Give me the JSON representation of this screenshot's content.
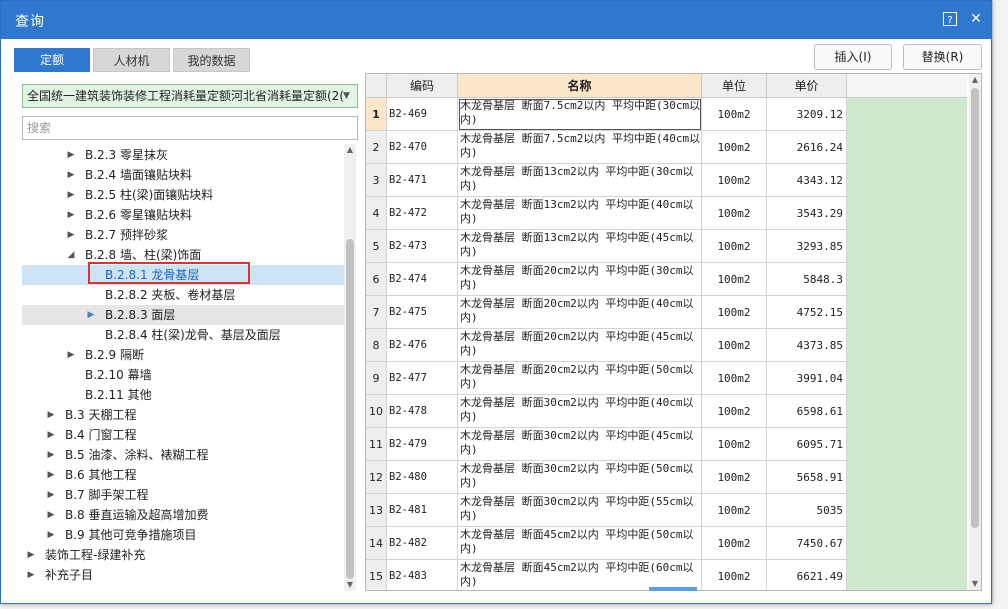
{
  "dialog": {
    "title": "查询",
    "help_icon": "?",
    "close_icon": "✕"
  },
  "tabs": [
    {
      "label": "定额",
      "active": true
    },
    {
      "label": "人材机",
      "active": false
    },
    {
      "label": "我的数据",
      "active": false
    }
  ],
  "actions": {
    "insert_label": "插入(I)",
    "replace_label": "替换(R)"
  },
  "library_select": {
    "value": "全国统一建筑装饰装修工程消耗量定额河北省消耗量定额(2("
  },
  "search": {
    "placeholder": "搜索"
  },
  "tree": {
    "items": [
      {
        "label": "B.2.3 零星抹灰",
        "expanded": false
      },
      {
        "label": "B.2.4 墙面镶贴块料",
        "expanded": false
      },
      {
        "label": "B.2.5 柱(梁)面镶贴块料",
        "expanded": false
      },
      {
        "label": "B.2.6 零星镶贴块料",
        "expanded": false
      },
      {
        "label": "B.2.7 预拌砂浆",
        "expanded": false
      },
      {
        "label": "B.2.8 墙、柱(梁)饰面",
        "expanded": true
      },
      {
        "label": "B.2.8.1 龙骨基层",
        "selected": true
      },
      {
        "label": "B.2.8.2 夹板、卷材基层"
      },
      {
        "label": "B.2.8.3 面层",
        "hover": true
      },
      {
        "label": "B.2.8.4 柱(梁)龙骨、基层及面层"
      },
      {
        "label": "B.2.9 隔断",
        "expanded": false
      },
      {
        "label": "B.2.10 幕墙"
      },
      {
        "label": "B.2.11 其他"
      },
      {
        "label": "B.3 天棚工程",
        "expanded": false
      },
      {
        "label": "B.4 门窗工程",
        "expanded": false
      },
      {
        "label": "B.5 油漆、涂料、裱糊工程",
        "expanded": false
      },
      {
        "label": "B.6 其他工程",
        "expanded": false
      },
      {
        "label": "B.7 脚手架工程",
        "expanded": false
      },
      {
        "label": "B.8 垂直运输及超高增加费",
        "expanded": false
      },
      {
        "label": "B.9 其他可竞争措施项目",
        "expanded": false
      },
      {
        "label": "装饰工程-绿建补充",
        "expanded": false
      },
      {
        "label": "补充子目",
        "expanded": false
      }
    ]
  },
  "grid": {
    "headers": {
      "rownum": "",
      "code": "编码",
      "name": "名称",
      "unit": "单位",
      "price": "单价"
    },
    "rows": [
      {
        "n": "1",
        "code": "B2-469",
        "name": "木龙骨基层 断面7.5cm2以内 平均中距(30cm以内)",
        "unit": "100m2",
        "price": "3209.12"
      },
      {
        "n": "2",
        "code": "B2-470",
        "name": "木龙骨基层 断面7.5cm2以内 平均中距(40cm以内)",
        "unit": "100m2",
        "price": "2616.24"
      },
      {
        "n": "3",
        "code": "B2-471",
        "name": "木龙骨基层 断面13cm2以内 平均中距(30cm以内)",
        "unit": "100m2",
        "price": "4343.12"
      },
      {
        "n": "4",
        "code": "B2-472",
        "name": "木龙骨基层 断面13cm2以内 平均中距(40cm以内)",
        "unit": "100m2",
        "price": "3543.29"
      },
      {
        "n": "5",
        "code": "B2-473",
        "name": "木龙骨基层 断面13cm2以内 平均中距(45cm以内)",
        "unit": "100m2",
        "price": "3293.85"
      },
      {
        "n": "6",
        "code": "B2-474",
        "name": "木龙骨基层 断面20cm2以内 平均中距(30cm以内)",
        "unit": "100m2",
        "price": "5848.3"
      },
      {
        "n": "7",
        "code": "B2-475",
        "name": "木龙骨基层 断面20cm2以内 平均中距(40cm以内)",
        "unit": "100m2",
        "price": "4752.15"
      },
      {
        "n": "8",
        "code": "B2-476",
        "name": "木龙骨基层 断面20cm2以内 平均中距(45cm以内)",
        "unit": "100m2",
        "price": "4373.85"
      },
      {
        "n": "9",
        "code": "B2-477",
        "name": "木龙骨基层 断面20cm2以内 平均中距(50cm以内)",
        "unit": "100m2",
        "price": "3991.04"
      },
      {
        "n": "10",
        "code": "B2-478",
        "name": "木龙骨基层 断面30cm2以内 平均中距(40cm以内)",
        "unit": "100m2",
        "price": "6598.61"
      },
      {
        "n": "11",
        "code": "B2-479",
        "name": "木龙骨基层 断面30cm2以内 平均中距(45cm以内)",
        "unit": "100m2",
        "price": "6095.71"
      },
      {
        "n": "12",
        "code": "B2-480",
        "name": "木龙骨基层 断面30cm2以内 平均中距(50cm以内)",
        "unit": "100m2",
        "price": "5658.91"
      },
      {
        "n": "13",
        "code": "B2-481",
        "name": "木龙骨基层 断面30cm2以内 平均中距(55cm以内)",
        "unit": "100m2",
        "price": "5035"
      },
      {
        "n": "14",
        "code": "B2-482",
        "name": "木龙骨基层 断面45cm2以内 平均中距(50cm以内)",
        "unit": "100m2",
        "price": "7450.67"
      },
      {
        "n": "15",
        "code": "B2-483",
        "name": "木龙骨基层 断面45cm2以内 平均中距(60cm以内)",
        "unit": "100m2",
        "price": "6621.49"
      }
    ]
  },
  "colors": {
    "titlebar": "#2f77cf",
    "selected_row": "#cde4f7",
    "highlight_box": "#e03030",
    "active_header": "#fbe7c8",
    "green_column": "#cfe9cf"
  }
}
